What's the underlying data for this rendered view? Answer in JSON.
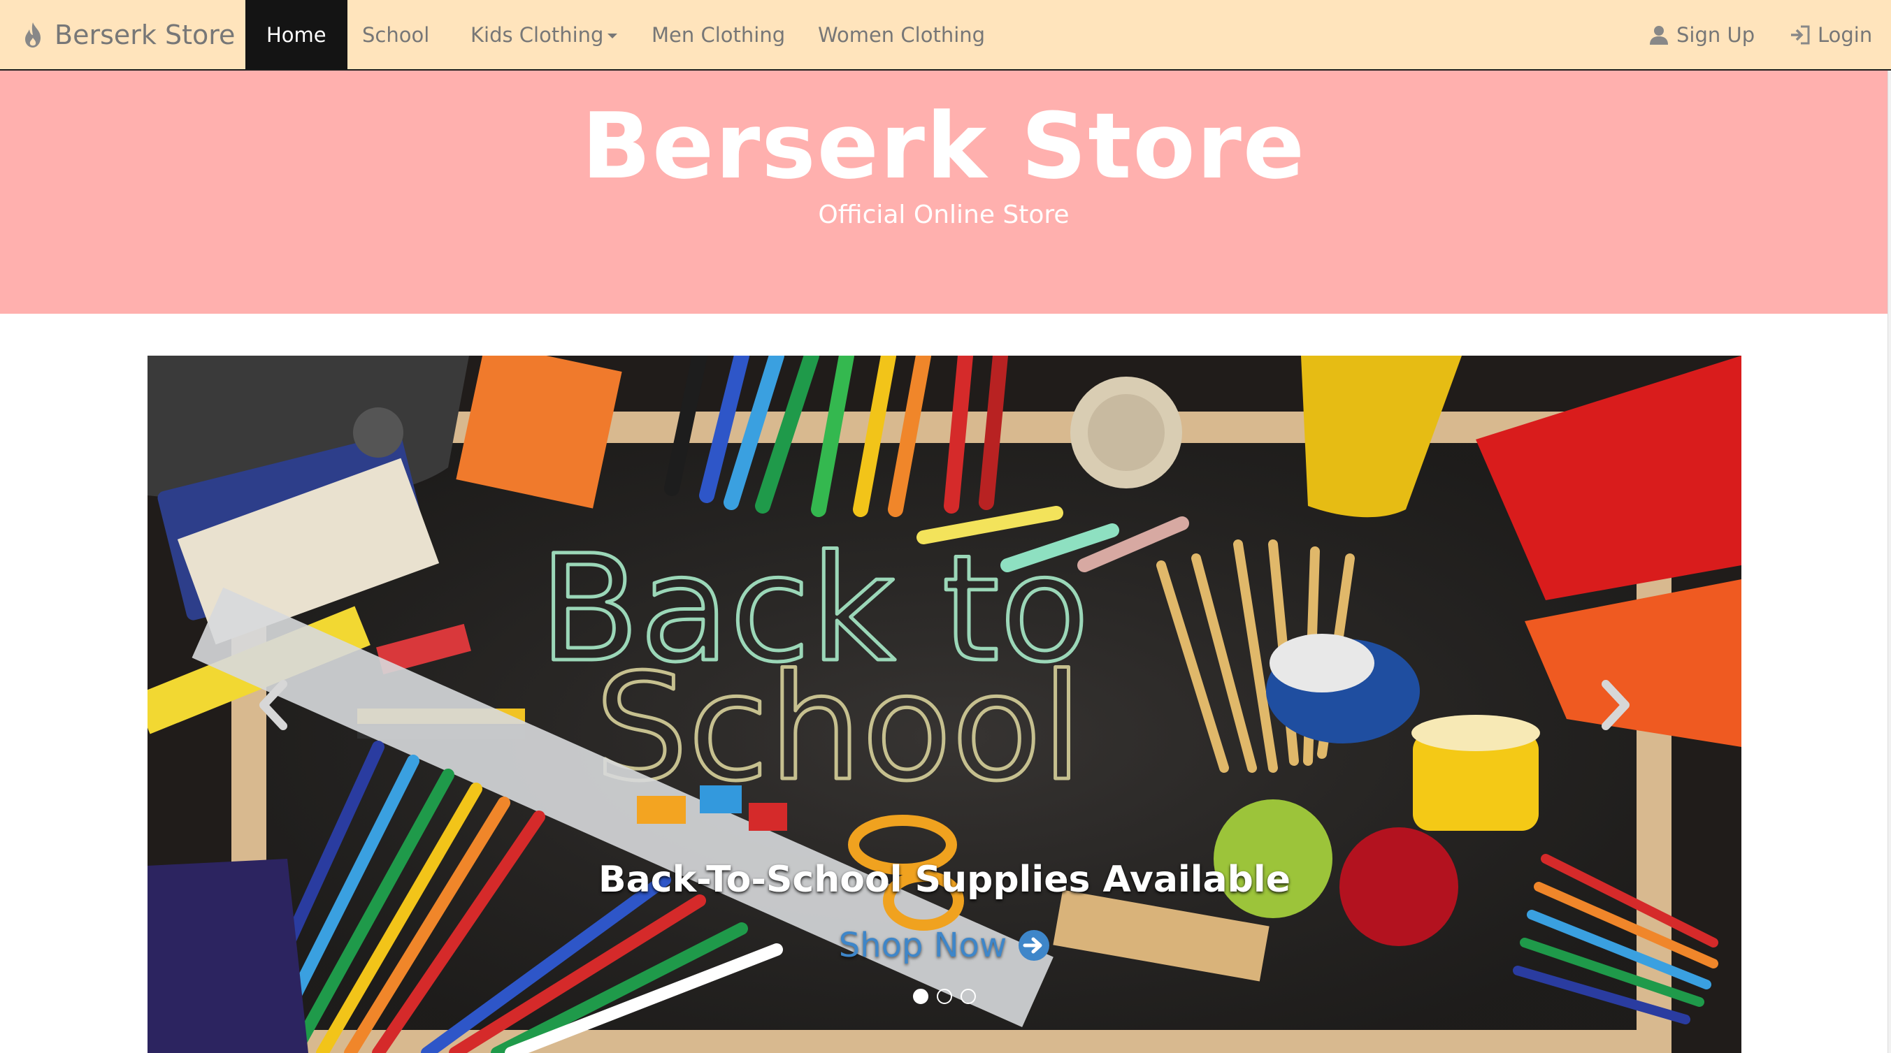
{
  "navbar": {
    "brand": "Berserk Store",
    "brand_icon": "fire-icon",
    "items": [
      {
        "label": "Home",
        "active": true
      },
      {
        "label": "School",
        "active": false
      },
      {
        "label": "Kids Clothing",
        "active": false,
        "dropdown": true
      },
      {
        "label": "Men Clothing",
        "active": false
      },
      {
        "label": "Women Clothing",
        "active": false
      }
    ],
    "signup": {
      "label": "Sign Up",
      "icon": "user-icon"
    },
    "login": {
      "label": "Login",
      "icon": "login-icon"
    }
  },
  "jumbotron": {
    "title": "Berserk Store",
    "subtitle": "Official Online Store"
  },
  "carousel": {
    "image_text": [
      "Back to",
      "School"
    ],
    "caption": "Back-To-School Supplies Available",
    "cta": "Shop Now",
    "cta_icon": "arrow-circle-right-icon",
    "slide_count": 3,
    "active_slide": 1
  },
  "colors": {
    "navbar_bg": "#ffe4bc",
    "jumbotron_bg": "#ffb0ae",
    "active_nav_bg": "#141414",
    "cta": "#3e86c9"
  }
}
